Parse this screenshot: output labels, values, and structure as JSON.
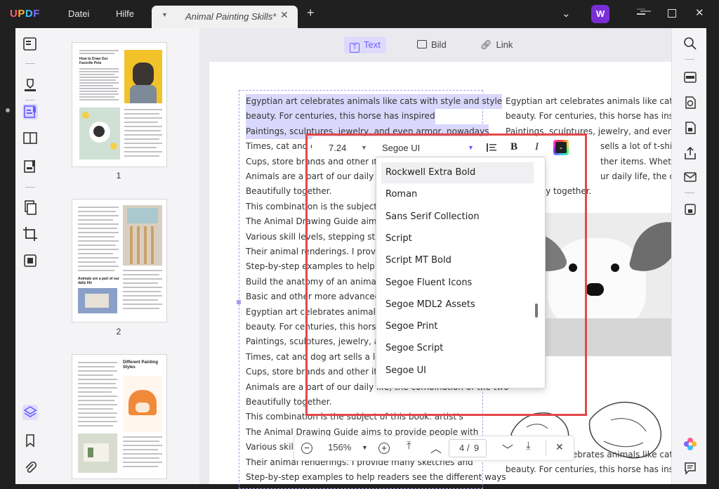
{
  "app": {
    "logo": "UPDF"
  },
  "menu": {
    "file": "Datei",
    "help": "Hilfe"
  },
  "tab": {
    "title": "Animal Painting Skills*",
    "close": "✕",
    "new": "+"
  },
  "user": {
    "initial": "W"
  },
  "edit_modes": {
    "text": "Text",
    "image": "Bild",
    "link": "Link"
  },
  "format_bar": {
    "font_size": "7.24",
    "font_name": "Segoe UI",
    "bold": "B",
    "italic": "I"
  },
  "font_options": [
    "Rockwell Extra Bold",
    "Roman",
    "Sans Serif Collection",
    "Script",
    "Script MT Bold",
    "Segoe Fluent Icons",
    "Segoe MDL2 Assets",
    "Segoe Print",
    "Segoe Script",
    "Segoe UI"
  ],
  "thumbnails": {
    "page1_number": "1",
    "page1_heading": "How to Draw Our Favorite Pets",
    "page2_number": "2",
    "page2_heading": "Animals are a part of our daily life",
    "page3_heading": "Different Painting Styles"
  },
  "document": {
    "left_column": [
      "Egyptian art celebrates animals like cats with style and style",
      "beauty. For centuries, this horse has inspired",
      "Paintings, sculptures, jewelry, and even armor, nowadays",
      "Times, cat and dog",
      "Cups, store brands and other items.",
      "Animals are a part of our daily life, th",
      "Beautifully together.",
      "This combination is the subject of th",
      "The Animal Drawing Guide aims to p",
      "Various skill levels, stepping stones",
      "Their animal renderings. I provide m",
      "Step-by-step examples to help reade",
      "Build the anatomy of an animal. sor",
      "Basic and other more advanced one",
      "Egyptian art celebrates animals like",
      "beauty. For centuries, this horse has",
      "Paintings, sculptures, jewelry, and e",
      "Times, cat and dog art sells a lot of t",
      "Cups, store brands and other items.",
      "Animals are a part of our daily life, the combination of the two",
      "Beautifully together.",
      "This combination is the subject of this book. artist's",
      "The Animal Drawing Guide aims to provide people with",
      "Various skill",
      "Their animal renderings. I provide many sketches and",
      "Step-by-step examples to help readers see the different ways"
    ],
    "right_column": [
      "Egyptian art celebrates animals like cats with",
      "beauty. For centuries, this horse has inspired",
      "Paintings, sculptures, jewelry, and even armor,",
      "sells a lot of t-shirts, c",
      "ther items. Whether",
      "ur daily life, the combi",
      "Beautifully together."
    ],
    "right_column_bottom": [
      "Egyptian art celebrates animals like cats with",
      "beauty. For centuries, this horse has inspired"
    ]
  },
  "zoom_bar": {
    "zoom": "156%",
    "current_page": "4",
    "separator": "/",
    "total_pages": "9"
  }
}
